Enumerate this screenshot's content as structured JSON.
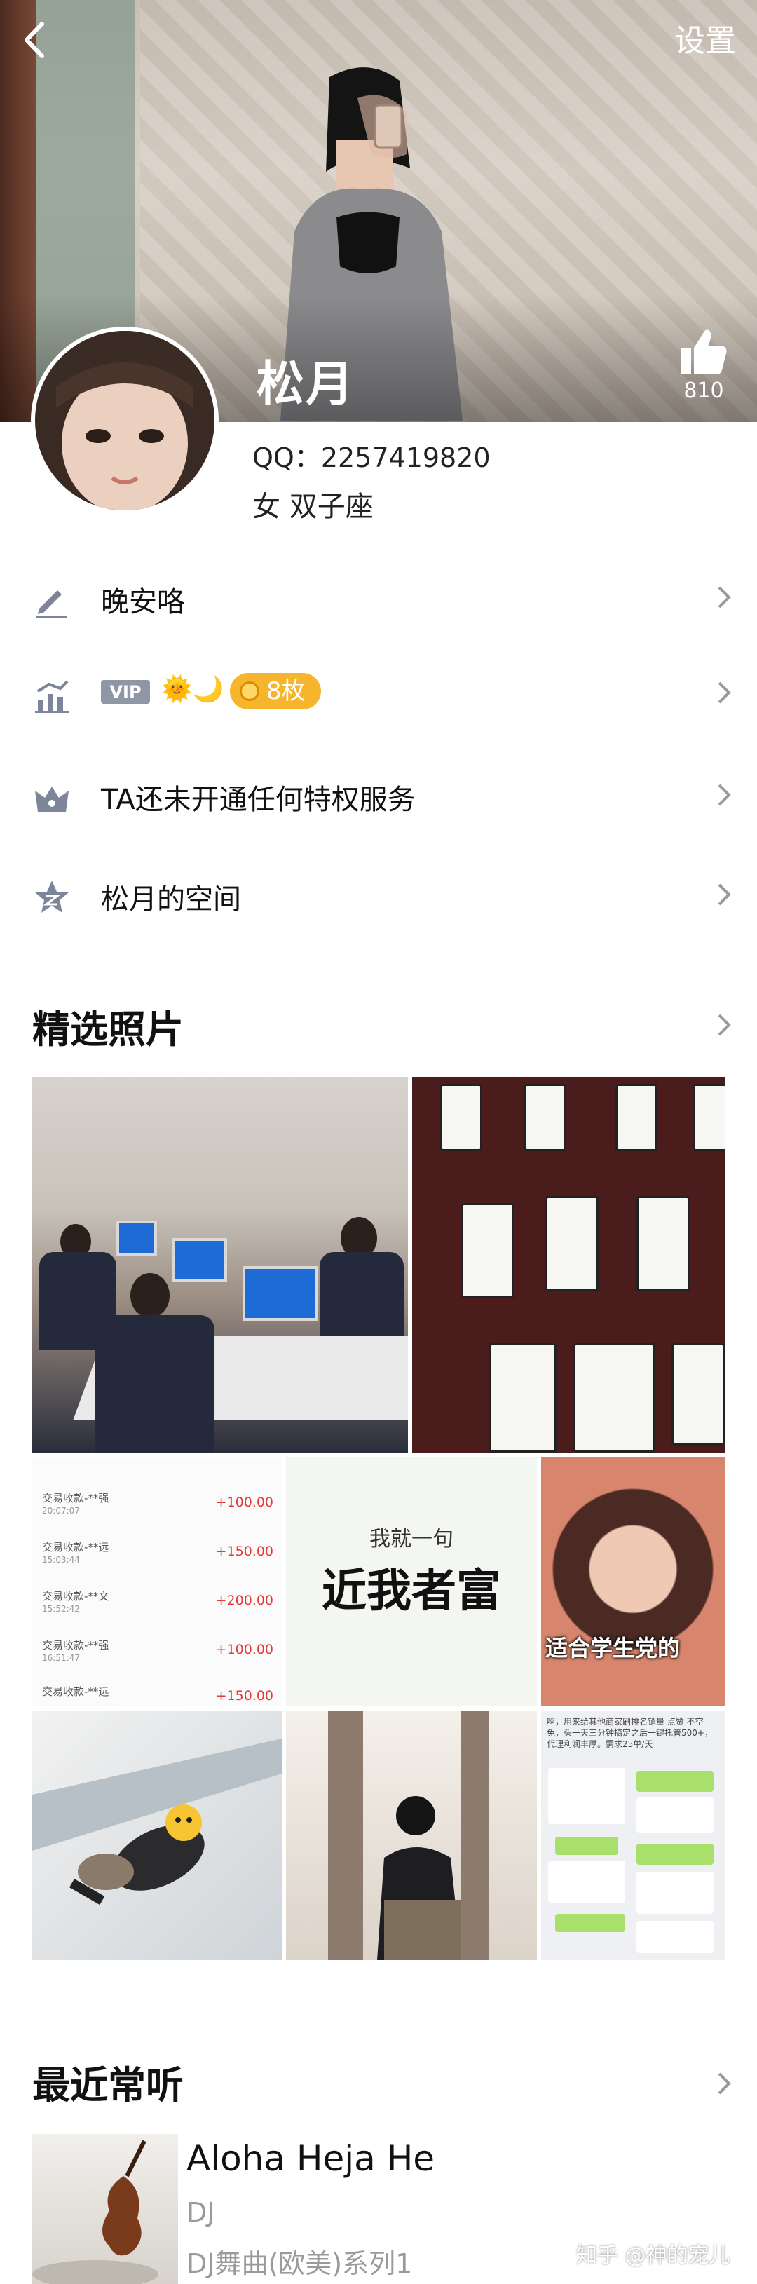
{
  "header": {
    "back_icon": "chevron-left-icon",
    "settings_label": "设置",
    "username": "松月",
    "like_count": "810"
  },
  "profile": {
    "qq": "QQ：2257419820",
    "gender_sign": "女  双子座"
  },
  "rows": {
    "signature": "晚安咯",
    "vip_badge": "VIP",
    "sun_moon": "🌞🌙",
    "coins": "8枚",
    "privilege": "TA还未开通任何特权服务",
    "space": "松月的空间"
  },
  "photos": {
    "section_title": "精选照片",
    "transactions": [
      {
        "name": "交易收款-**强",
        "time": "20:07:07",
        "amount": "+100.00"
      },
      {
        "name": "交易收款-**远",
        "time": "15:03:44",
        "amount": "+150.00"
      },
      {
        "name": "交易收款-**文",
        "time": "15:52:42",
        "amount": "+200.00"
      },
      {
        "name": "交易收款-**强",
        "time": "16:51:47",
        "amount": "+100.00"
      },
      {
        "name": "交易收款-**远",
        "time": "",
        "amount": "+150.00"
      }
    ],
    "meme_small": "我就一句",
    "meme_big": "近我者富",
    "student_caption": "适合学生党的",
    "chat_text": "啊，用来给其他商家刷排名销量 点赞 不空免，头一天三分钟搞定之后一键托管500+，代理利润丰厚。需求25单/天"
  },
  "music": {
    "section_title": "最近常听",
    "song_title": "Aloha Heja He",
    "artist": "DJ",
    "album": "DJ舞曲(欧美)系列1"
  },
  "watermark": "知乎 @神的宠儿",
  "colors": {
    "accent_coin": "#f7b52e",
    "vip_badge": "#8f96a6",
    "icon_gray": "#7d8598",
    "amount_red": "#e53935"
  }
}
